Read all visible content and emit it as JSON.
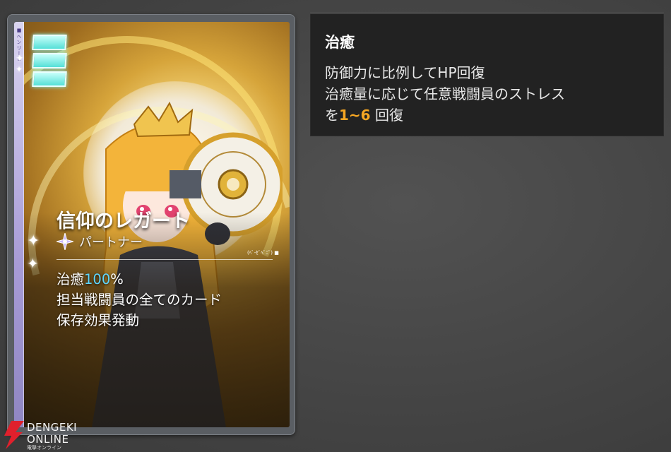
{
  "card": {
    "name": "信仰のレガート",
    "type": "パートナー",
    "side_label": "■ヘンリーヒ",
    "small_tag": "(ﾍﾞ-ｾﾞﾍﾞﾆﾞ) ■",
    "cost_pips": 3,
    "effect_line1_prefix": "治癒",
    "effect_line1_value": "100",
    "effect_line1_suffix": "%",
    "effect_line2": "担当戦闘員の全てのカード",
    "effect_line3": "保存効果発動",
    "colors": {
      "highlight": "#5fd6ff",
      "pip": "#55e0d8",
      "side_strip": "#a79bd6"
    }
  },
  "tooltip": {
    "title": "治癒",
    "line1": "防御力に比例してHP回復",
    "line2": "治癒量に応じて任意戦闘員のストレス",
    "line3_prefix": "を",
    "line3_value": "1~6",
    "line3_suffix": "回復",
    "colors": {
      "value": "#f5a623"
    }
  },
  "watermark": {
    "line1": "DENGEKI",
    "line2": "ONLINE",
    "line3": "電撃オンライン",
    "icon": "lightning-icon"
  },
  "icons": {
    "card_type": "four-point-star-icon",
    "sparkle": "sparkle-icon"
  }
}
